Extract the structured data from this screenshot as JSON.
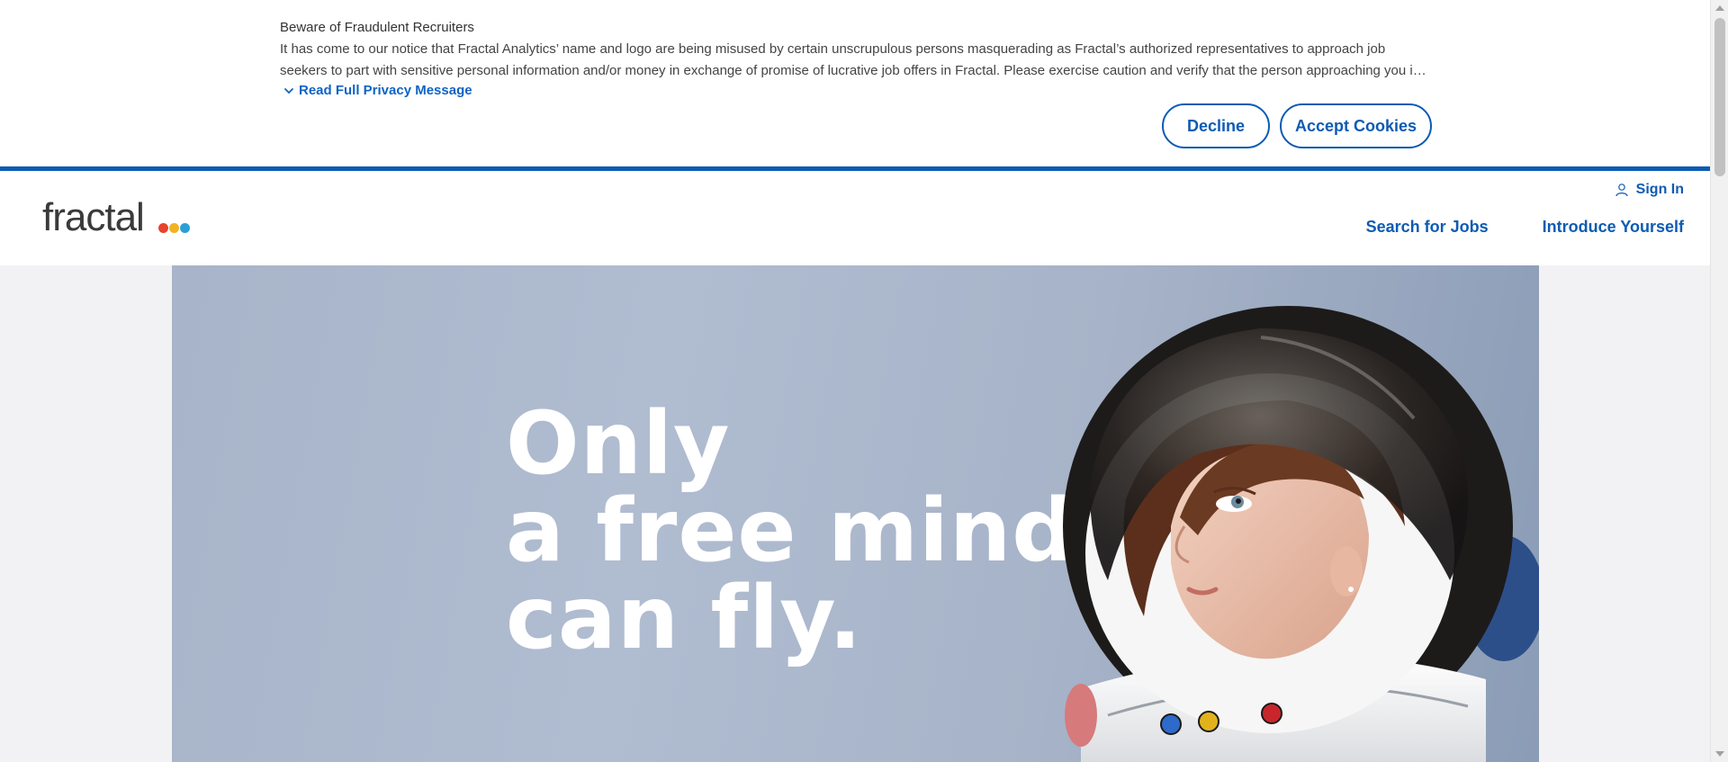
{
  "banner": {
    "title": "Beware of Fraudulent Recruiters",
    "text": "It has come to our notice that Fractal Analytics’ name and logo are being misused by certain unscrupulous persons masquerading as Fractal’s authorized representatives to approach job seekers to part with sensitive personal information and/or money in exchange of promise of lucrative job offers in Fractal. Please exercise caution and verify that the person approaching you i…",
    "read_more_label": "Read Full Privacy Message",
    "decline_label": "Decline",
    "accept_label": "Accept Cookies"
  },
  "header": {
    "logo_text": "fractal",
    "logo_dot_colors": [
      "#e8442d",
      "#f0b323",
      "#2a9fd8"
    ],
    "sign_in_label": "Sign In",
    "nav": {
      "search_jobs": "Search for Jobs",
      "introduce_yourself": "Introduce Yourself"
    }
  },
  "hero": {
    "headline": {
      "line1": "Only",
      "line2": "a free mind",
      "line3": "can fly."
    }
  },
  "colors": {
    "brand_blue": "#0d5bb3",
    "link_blue": "#0f63c4",
    "hero_bg": "#a8b4c9"
  }
}
